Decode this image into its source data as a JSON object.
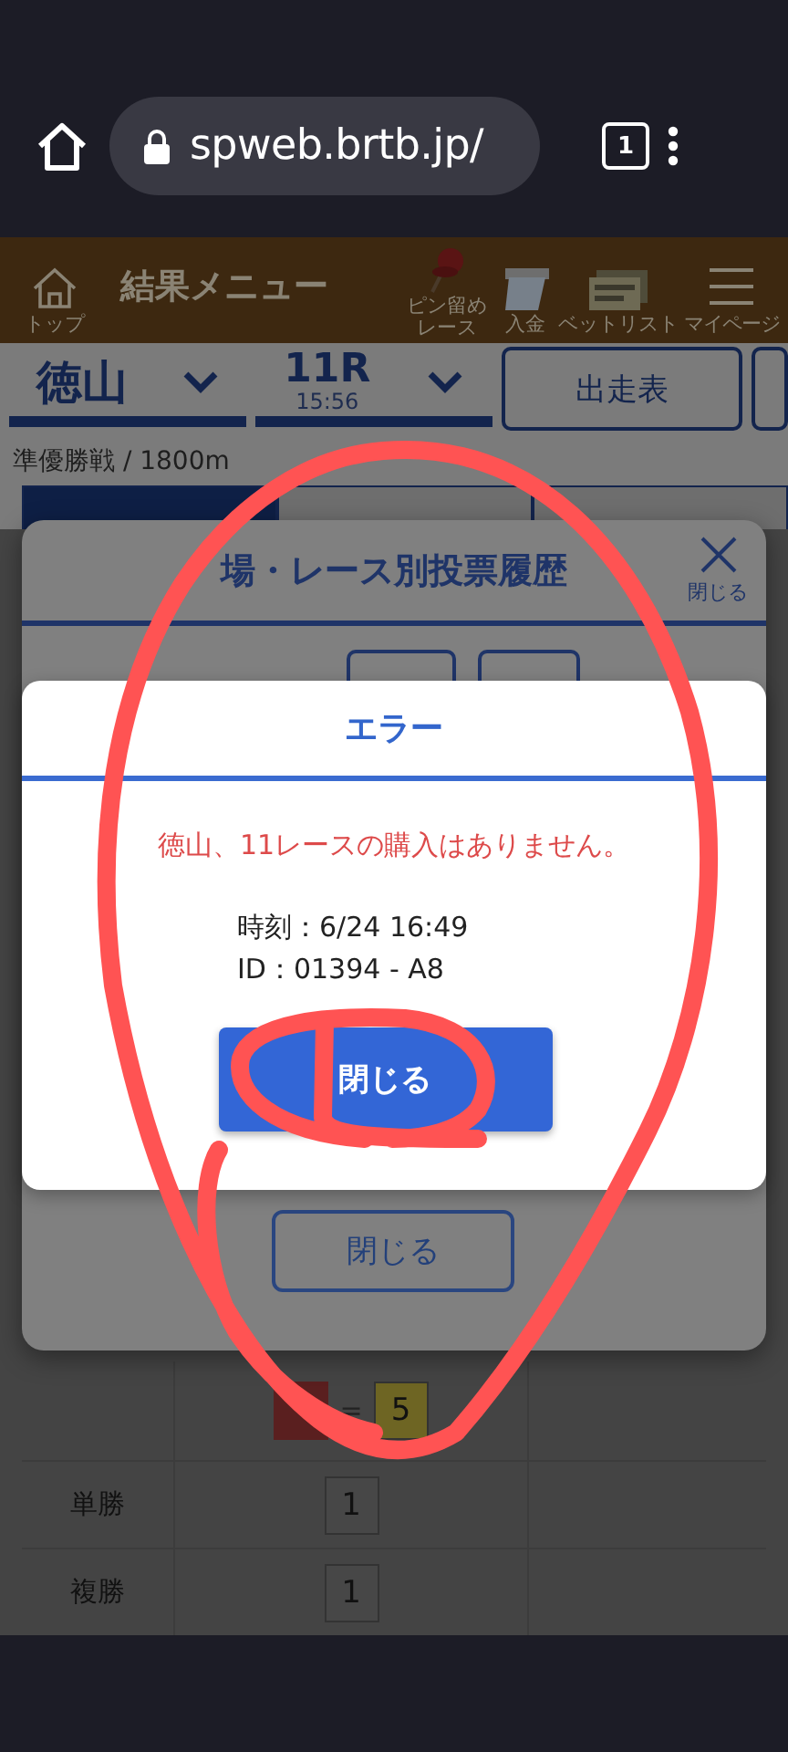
{
  "browser": {
    "url": "spweb.brtb.jp/",
    "tab_count": "1"
  },
  "header": {
    "items": [
      {
        "kind": "home",
        "label": "トップ"
      },
      {
        "kind": "title",
        "label": "結果メニュー"
      },
      {
        "kind": "pin",
        "label": "ピン留めレース"
      },
      {
        "kind": "deposit",
        "label": "入金"
      },
      {
        "kind": "bets",
        "label": "ベットリスト"
      },
      {
        "kind": "menu",
        "label": "マイページ"
      }
    ]
  },
  "race_bar": {
    "venue": "徳山",
    "race": "11R",
    "time": "15:56",
    "button": "出走表"
  },
  "race_info": "準優勝戦 / 1800m",
  "tabs": [
    {
      "selected": true
    },
    {
      "selected": false
    },
    {
      "selected": false
    }
  ],
  "history_modal": {
    "title": "場・レース別投票履歴",
    "close_label": "閉じる",
    "button": "閉じる"
  },
  "error_dialog": {
    "title": "エラー",
    "message": "徳山、11レースの購入はありません。",
    "details": [
      "時刻：6/24 16:49",
      "ID：01394 - A8"
    ],
    "button": "閉じる"
  },
  "result_table": {
    "rows": [
      {
        "numbers": [
          {
            "color": "#5a1f1f"
          },
          {
            "text": "5",
            "color": "#6e6523"
          }
        ],
        "joiner": "="
      },
      {
        "bet_type": "単勝",
        "numbers": [
          {
            "text": "1",
            "color": "#474747"
          }
        ]
      },
      {
        "bet_type": "複勝",
        "numbers": [
          {
            "text": "1",
            "color": "#474747"
          }
        ]
      }
    ]
  }
}
